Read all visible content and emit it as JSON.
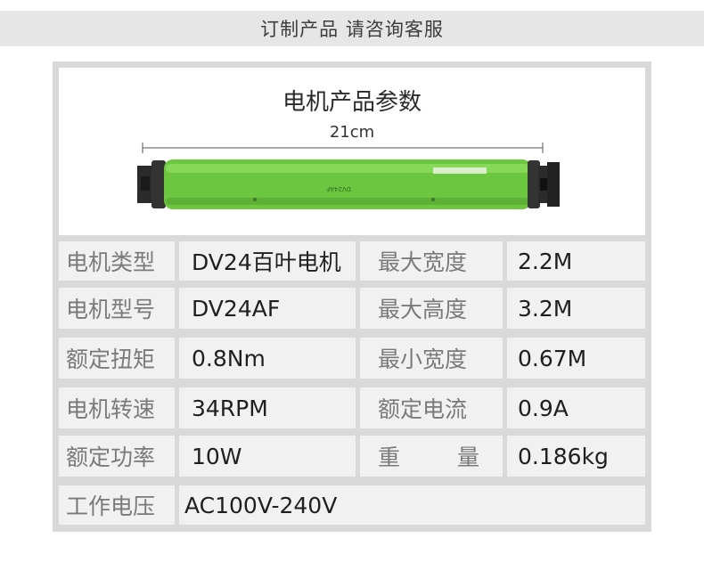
{
  "banner": {
    "text": "订制产品 请咨询客服"
  },
  "product_image": {
    "title": "电机产品参数",
    "length_label": "21cm",
    "tube_print": "DV24AF"
  },
  "specs": {
    "rows": [
      {
        "label": "电机类型",
        "value": "DV24百叶电机",
        "label2": "最大宽度",
        "value2": "2.2M"
      },
      {
        "label": "电机型号",
        "value": "DV24AF",
        "label2": "最大高度",
        "value2": "3.2M"
      },
      {
        "label": "额定扭矩",
        "value": "0.8Nm",
        "label2": "最小宽度",
        "value2": "0.67M"
      },
      {
        "label": "电机转速",
        "value": "34RPM",
        "label2": "额定电流",
        "value2": "0.9A"
      },
      {
        "label": "额定功率",
        "value": "10W",
        "label2_a": "重",
        "label2_b": "量",
        "value2": "0.186kg"
      }
    ],
    "voltage": {
      "label": "工作电压",
      "value": "AC100V-240V"
    }
  },
  "colors": {
    "tube_green": "#6cc640",
    "tube_highlight": "#8fdc5e",
    "end_cap": "#2b2b2b",
    "cell_bg": "#f1f1f1",
    "frame_bg": "#d9d9d9"
  }
}
